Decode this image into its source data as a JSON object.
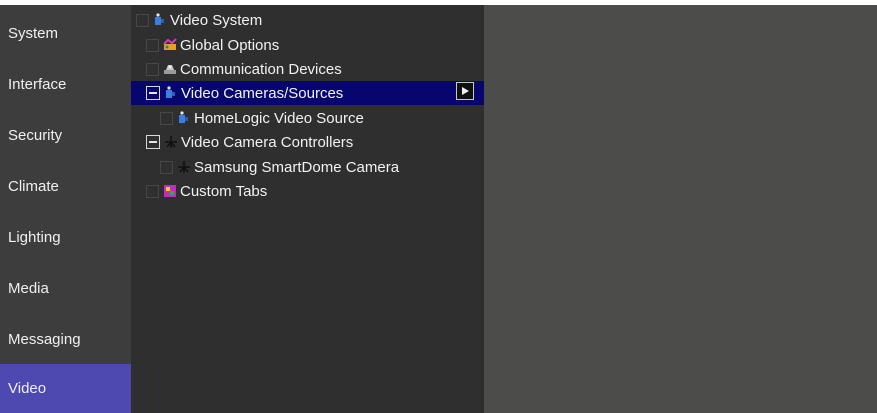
{
  "sidebar": {
    "items": [
      {
        "label": "System"
      },
      {
        "label": "Interface"
      },
      {
        "label": "Security"
      },
      {
        "label": "Climate"
      },
      {
        "label": "Lighting"
      },
      {
        "label": "Media"
      },
      {
        "label": "Messaging"
      },
      {
        "label": "Video"
      }
    ],
    "active": "Video"
  },
  "tree": {
    "nodes": [
      {
        "label": "Video System",
        "icon": "video-camera-icon"
      },
      {
        "label": "Global Options",
        "icon": "global-options-icon"
      },
      {
        "label": "Communication Devices",
        "icon": "communication-devices-icon"
      },
      {
        "label": "Video Cameras/Sources",
        "icon": "video-camera-icon",
        "selected": true
      },
      {
        "label": "HomeLogic Video Source",
        "icon": "video-camera-icon"
      },
      {
        "label": "Video Camera Controllers",
        "icon": "camera-controller-icon"
      },
      {
        "label": "Samsung SmartDome Camera",
        "icon": "camera-controller-icon"
      },
      {
        "label": "Custom Tabs",
        "icon": "custom-tabs-icon"
      }
    ]
  },
  "colors": {
    "sidebar_bg": "#3d3d3d",
    "sidebar_active": "#4e49b0",
    "tree_bg": "#2f2f2f",
    "selection": "#06066e",
    "right_pane_bg": "#4c4c4a"
  }
}
